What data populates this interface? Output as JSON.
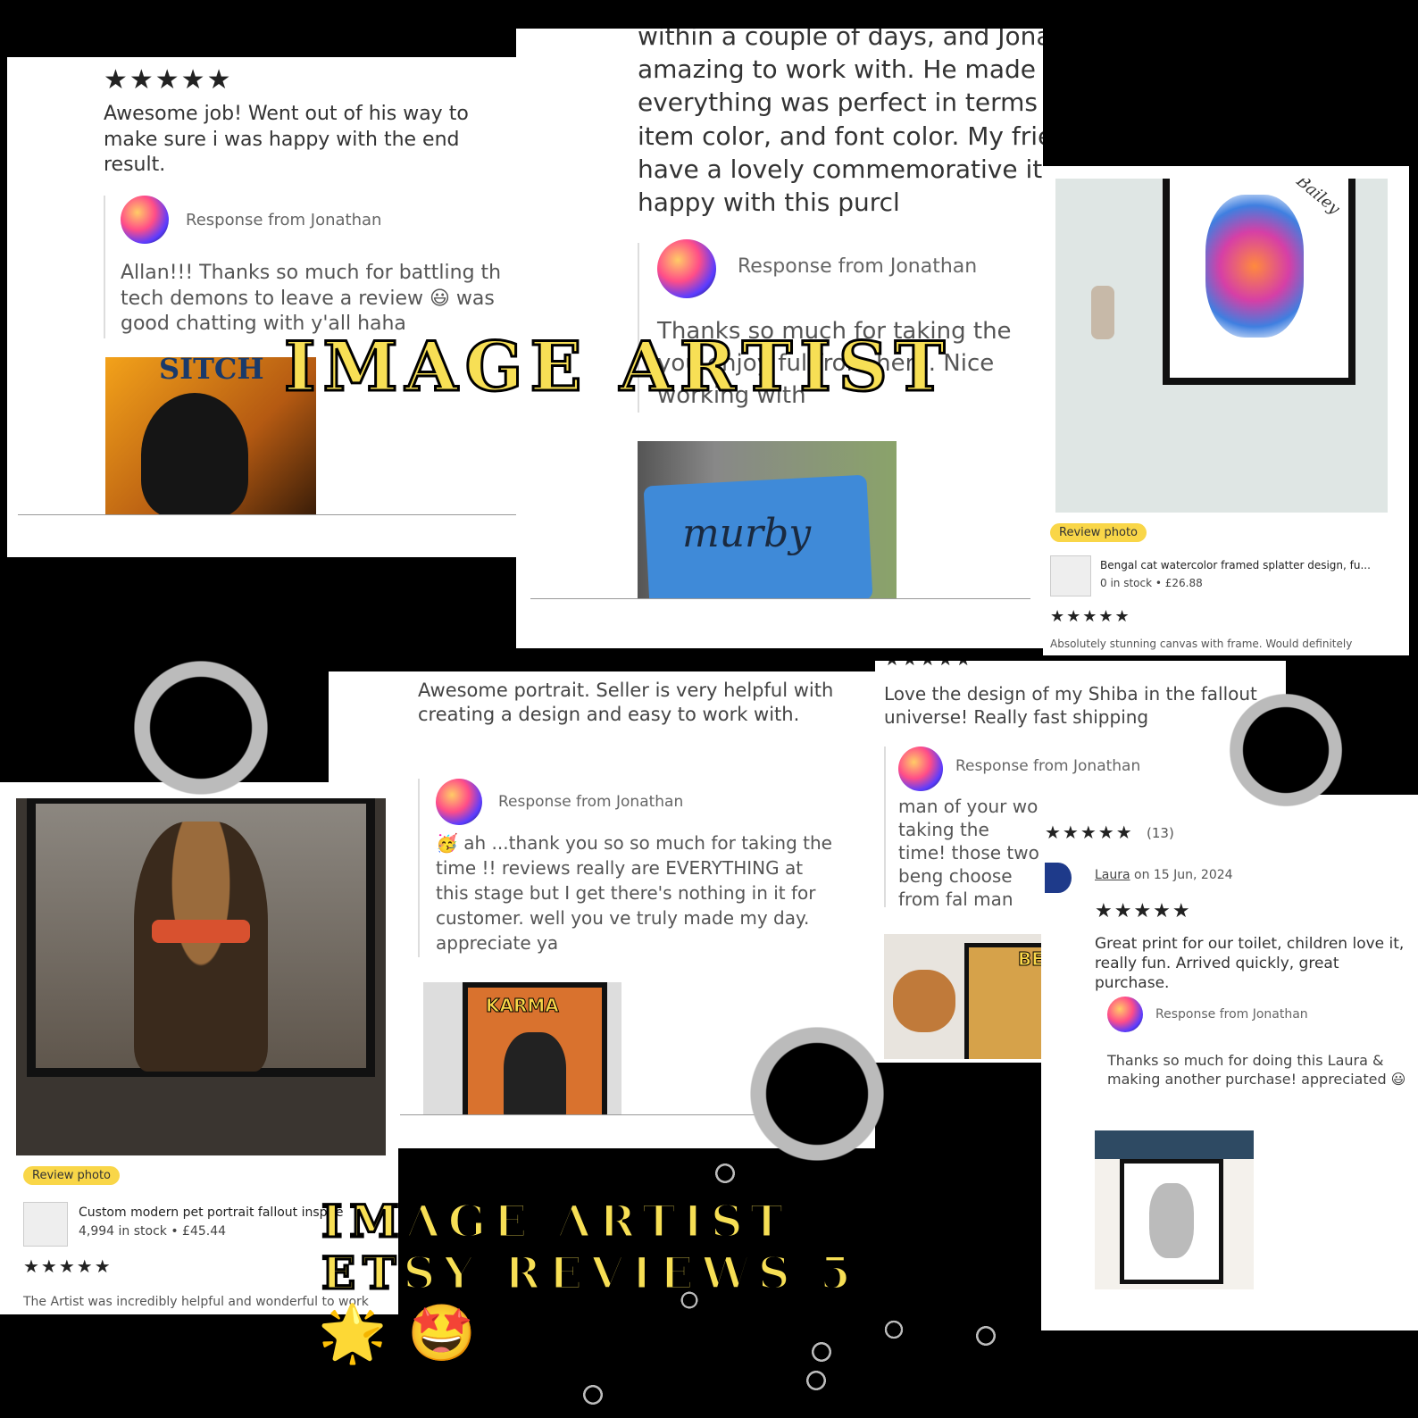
{
  "card1": {
    "stars": "★★★★★",
    "text": "Awesome job! Went out of his way to make sure i was happy with the end result.",
    "response_label": "Response from Jonathan",
    "response": "Allan!!! Thanks so much for battling th tech demons to leave a review 😃 was good chatting with y'all haha",
    "photo_label": "SITCH"
  },
  "card2": {
    "text": "within a couple of days, and Jonathan was amazing to work with. He made sure everything was perfect in terms of art, item color, and font color. My friend will have a lovely commemorative it Incredibly happy with this purcl",
    "response_label": "Response from Jonathan",
    "response": "Thanks so much for taking the you enjoy ful from here. Nice working with",
    "photo_label": "murby"
  },
  "card3": {
    "painting_label": "Bailey",
    "badge": "Review photo",
    "product_name": "Bengal cat watercolor framed splatter design, fu...",
    "product_meta": "0 in stock • £26.88",
    "stars": "★★★★★",
    "text": "Absolutely stunning canvas with frame. Would definitely"
  },
  "card4": {
    "badge": "Review photo",
    "product_name": "Custom modern pet portrait fallout inspire",
    "product_meta": "4,994 in stock • £45.44",
    "stars": "★★★★★",
    "text": "The Artist was incredibly helpful and wonderful to work"
  },
  "card5": {
    "text": "Awesome portrait. Seller is very helpful with creating a design and easy to work with.",
    "response_label": "Response from Jonathan",
    "response": "🥳 ah ...thank you so so much for taking the time !! reviews really are EVERYTHING at this stage but I get there's nothing in it for customer. well you ve truly made my day. appreciate ya",
    "photo_label": "KARMA"
  },
  "card6": {
    "stars": "★★★★★",
    "text": "Love the design of my Shiba in the fallout universe! Really fast shipping",
    "response_label": "Response from Jonathan",
    "response": "man of your wo taking the time! those two beng choose from fal man",
    "photo_label": "BE"
  },
  "card7": {
    "rating_stars": "★★★★★",
    "rating_count": "(13)",
    "reviewer": "Laura",
    "date": "on 15 Jun, 2024",
    "stars": "★★★★★",
    "text": "Great print for our toilet, children love it, really fun. Arrived quickly, great purchase.",
    "response_label": "Response from Jonathan",
    "response": "Thanks so much for doing this Laura & making another purchase! appreciated 😃"
  },
  "overlay": {
    "title_top": "IMAGE ARTIST",
    "title_bottom_1": "IMAGE ARTIST",
    "title_bottom_2": "ETSY REVIEWS 5",
    "emoji_star": "🌟",
    "emoji_face": "🤩"
  }
}
